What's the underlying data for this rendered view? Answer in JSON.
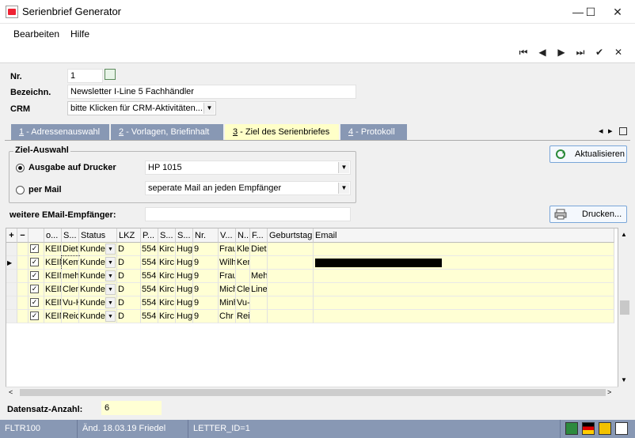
{
  "window": {
    "title": "Serienbrief Generator",
    "minimize": "—",
    "maximize": "☐",
    "close": "✕"
  },
  "menu": {
    "items": [
      {
        "label": "Bearbeiten"
      },
      {
        "label": "Hilfe"
      }
    ]
  },
  "nav": {
    "first": "⏮",
    "prev": "◀",
    "next": "▶",
    "last": "⏭",
    "confirm": "✔",
    "cancel": "✕"
  },
  "form": {
    "nr_label": "Nr.",
    "nr_value": "1",
    "bezeichn_label": "Bezeichn.",
    "bezeichn_value": "Newsletter I-Line 5 Fachhändler",
    "crm_label": "CRM",
    "crm_value": "bitte Klicken für CRM-Aktivitäten..."
  },
  "tabs": [
    {
      "num": "1",
      "label": " - Adressenauswahl",
      "active": false
    },
    {
      "num": "2",
      "label": " - Vorlagen, Briefinhalt",
      "active": false
    },
    {
      "num": "3",
      "label": " - Ziel des Serienbriefes",
      "active": true
    },
    {
      "num": "4",
      "label": " - Protokoll",
      "active": false
    }
  ],
  "tab_nav": {
    "left": "◂",
    "right": "▸"
  },
  "target": {
    "group_title": "Ziel-Auswahl",
    "printer_option": "Ausgabe auf Drucker",
    "printer_value": "HP 1015",
    "printer_selected": true,
    "mail_option": "per Mail",
    "mail_value": "seperate Mail an jeden Empfänger",
    "mail_selected": false,
    "refresh_button": "Aktualisieren",
    "extra_email_label": "weitere EMail-Empfänger:",
    "extra_email_value": "",
    "print_button": "Drucken..."
  },
  "grid": {
    "headers": [
      "+",
      "−",
      "o...",
      "S...",
      "Status",
      "LKZ",
      "P...",
      "S...",
      "S...",
      "Nr.",
      "V...",
      "N...",
      "F...",
      "Geburtstag",
      "Email"
    ],
    "rows": [
      {
        "checked": true,
        "o": "KEIN",
        "s": "Diet",
        "status": "Kunde",
        "lkz": "D",
        "p": "554",
        "s2": "Kirc",
        "s3": "Hug",
        "nr": "9",
        "v": "Frau",
        "n": "Klein",
        "f": "Diet",
        "geb": "",
        "email": "",
        "current": false,
        "email_redacted": false
      },
      {
        "checked": true,
        "o": "KEIN",
        "s": "Kem",
        "status": "Kunde",
        "lkz": "D",
        "p": "554",
        "s2": "Kirc",
        "s3": "Hug",
        "nr": "9",
        "v": "Wilh",
        "n": "Kem",
        "f": "",
        "geb": "",
        "email": "",
        "current": true,
        "email_redacted": true
      },
      {
        "checked": true,
        "o": "KEIN",
        "s": "meh",
        "status": "Kunde",
        "lkz": "D",
        "p": "554",
        "s2": "Kirc",
        "s3": "Hug",
        "nr": "9",
        "v": "Frau",
        "n": "",
        "f": "Meh",
        "geb": "",
        "email": "",
        "current": false,
        "email_redacted": false
      },
      {
        "checked": true,
        "o": "KEIN",
        "s": "Clen",
        "status": "Kunde",
        "lkz": "D",
        "p": "554",
        "s2": "Kirc",
        "s3": "Hug",
        "nr": "9",
        "v": "Mich",
        "n": "Clen",
        "f": "Line",
        "geb": "",
        "email": "",
        "current": false,
        "email_redacted": false
      },
      {
        "checked": true,
        "o": "KEIN",
        "s": "Vu-H",
        "status": "Kunde",
        "lkz": "D",
        "p": "554",
        "s2": "Kirc",
        "s3": "Hug",
        "nr": "9",
        "v": "Minh",
        "n": "Vu-H",
        "f": "",
        "geb": "",
        "email": "",
        "current": false,
        "email_redacted": false
      },
      {
        "checked": true,
        "o": "KEIN",
        "s": "Reic",
        "status": "Kunde",
        "lkz": "D",
        "p": "554",
        "s2": "Kirc",
        "s3": "Hug",
        "nr": "9",
        "v": "Chr",
        "n": "Reic",
        "f": "",
        "geb": "",
        "email": "",
        "current": false,
        "email_redacted": false
      }
    ]
  },
  "count": {
    "label": "Datensatz-Anzahl:",
    "value": "6"
  },
  "statusbar": {
    "form": "FLTR100",
    "changed": "Änd. 18.03.19 Friedel",
    "record": "LETTER_ID=1"
  }
}
